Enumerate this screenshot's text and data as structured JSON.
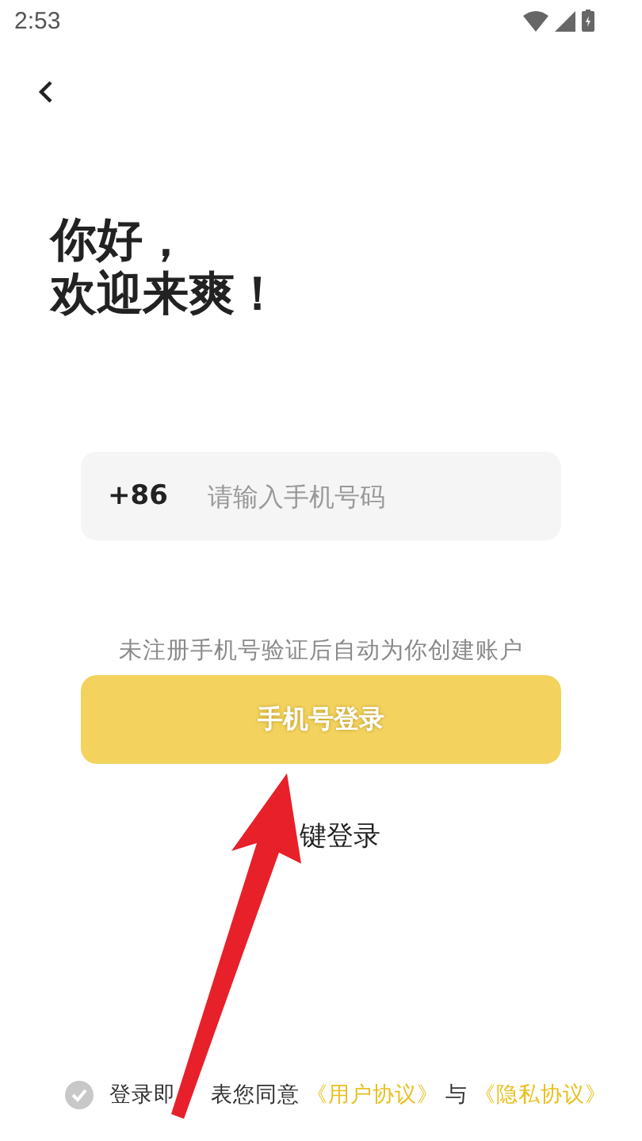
{
  "status_bar": {
    "time": "2:53"
  },
  "greeting": {
    "line_1": "你好，",
    "line_2": "欢迎来爽！"
  },
  "phone_field": {
    "country_code": "+86",
    "placeholder": "请输入手机号码"
  },
  "hint": "未注册手机号验证后自动为你创建账户",
  "login_button": {
    "label": "手机号登录",
    "disabled": true
  },
  "one_click_login": "键登录",
  "agreement": {
    "checked": false,
    "text_1": "登录即",
    "text_2": "表您同意",
    "link_1": "《用户协议》",
    "joiner": "与",
    "link_2": "《隐私协议》"
  }
}
